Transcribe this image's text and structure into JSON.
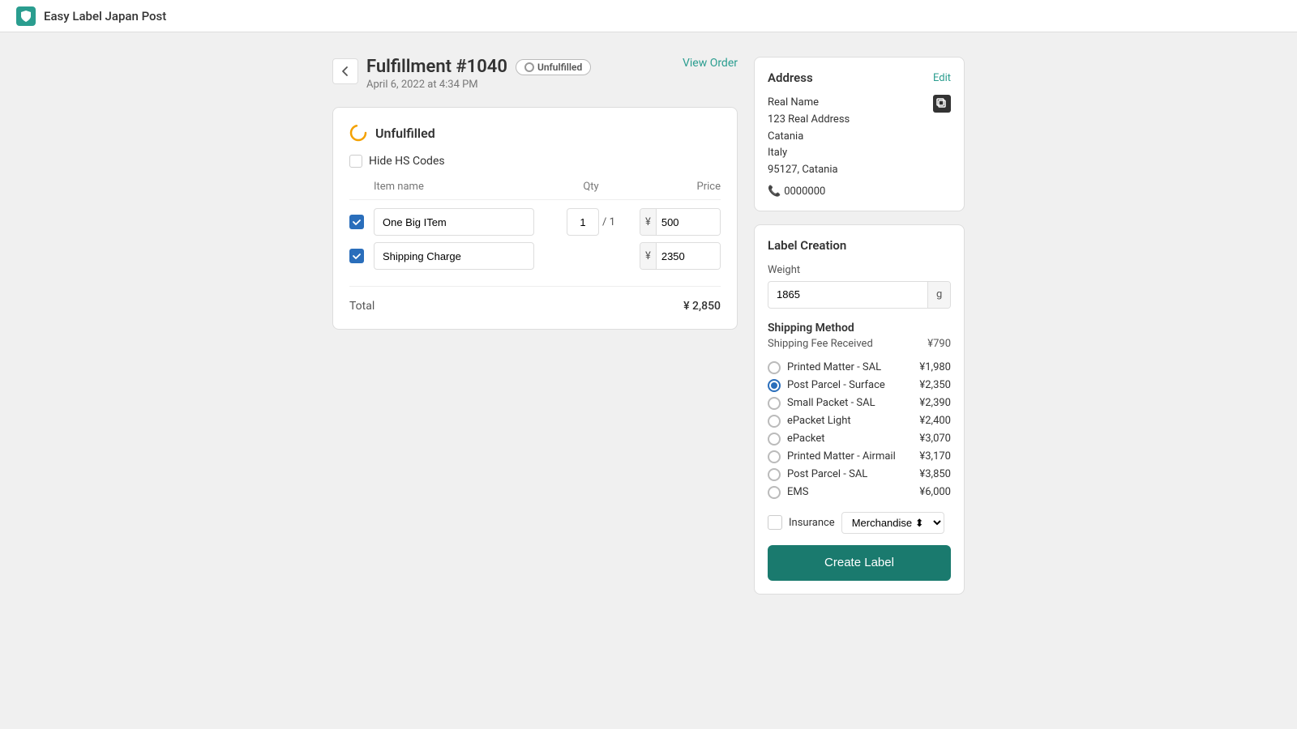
{
  "app": {
    "name": "Easy Label Japan Post",
    "logo_alt": "easy-label-logo"
  },
  "header": {
    "back_label": "←",
    "fulfillment_id": "Fulfillment #1040",
    "badge_label": "Unfulfilled",
    "date": "April 6, 2022 at 4:34 PM",
    "view_order": "View Order"
  },
  "items_section": {
    "title": "Unfulfilled",
    "hide_hs_label": "Hide HS Codes",
    "col_item_name": "Item name",
    "col_qty": "Qty",
    "col_price": "Price",
    "items": [
      {
        "name": "One Big ITem",
        "qty": "1",
        "qty_total": "/ 1",
        "price_prefix": "¥",
        "price": "500",
        "checked": true
      },
      {
        "name": "Shipping Charge",
        "qty": "",
        "qty_total": "",
        "price_prefix": "¥",
        "price": "2350",
        "checked": true
      }
    ],
    "total_label": "Total",
    "total_prefix": "¥",
    "total_value": "2,850"
  },
  "address": {
    "section_title": "Address",
    "edit_label": "Edit",
    "name": "Real Name",
    "street": "123 Real Address",
    "city": "Catania",
    "country": "Italy",
    "postal": "95127, Catania",
    "phone": "0000000"
  },
  "label_creation": {
    "section_title": "Label Creation",
    "weight_label": "Weight",
    "weight_value": "1865",
    "weight_unit": "g",
    "shipping_method_title": "Shipping Method",
    "shipping_fee_label": "Shipping Fee Received",
    "shipping_fee_value": "¥790",
    "options": [
      {
        "name": "Printed Matter - SAL",
        "price": "¥1,980",
        "selected": false
      },
      {
        "name": "Post Parcel - Surface",
        "price": "¥2,350",
        "selected": true
      },
      {
        "name": "Small Packet - SAL",
        "price": "¥2,390",
        "selected": false
      },
      {
        "name": "ePacket Light",
        "price": "¥2,400",
        "selected": false
      },
      {
        "name": "ePacket",
        "price": "¥3,070",
        "selected": false
      },
      {
        "name": "Printed Matter - Airmail",
        "price": "¥3,170",
        "selected": false
      },
      {
        "name": "Post Parcel - SAL",
        "price": "¥3,850",
        "selected": false
      },
      {
        "name": "EMS",
        "price": "¥6,000",
        "selected": false
      }
    ],
    "insurance_label": "Insurance",
    "merchandise_label": "Merchandise",
    "create_label_btn": "Create Label"
  }
}
